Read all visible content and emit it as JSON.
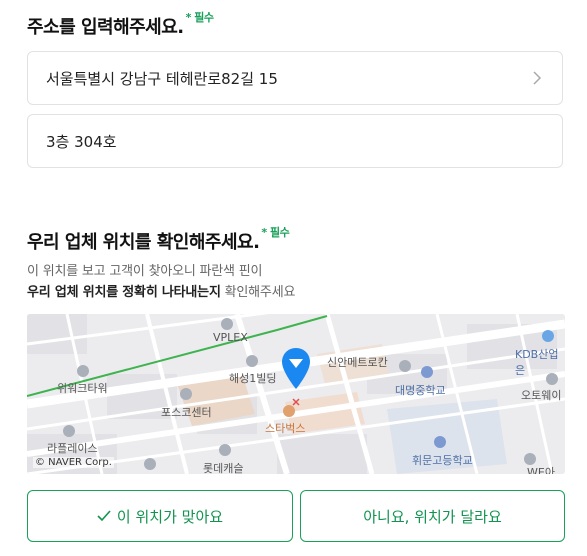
{
  "address_section": {
    "title": "주소를 입력해주세요.",
    "required": "* 필수",
    "address_value": "서울특별시 강남구 테헤란로82길 15",
    "detail_value": "3층 304호"
  },
  "location_section": {
    "title": "우리 업체 위치를 확인해주세요.",
    "required": "* 필수",
    "desc_line1": "이 위치를 보고 고객이 찾아오니 파란색 핀이",
    "desc_line2_bold": "우리 업체 위치를 정확히 나타내는지",
    "desc_line2_rest": " 확인해주세요"
  },
  "map": {
    "labels": {
      "vplex": "VPLEX",
      "wework": "위워크타워",
      "haesung": "해성1빌딩",
      "sinan": "신안메트로칸",
      "kdb": "KDB산업은",
      "posco": "포스코센터",
      "daemyung": "대명중학교",
      "ottoway": "오토웨이",
      "starbucks": "스타벅스",
      "lafeo": "라플레이스",
      "lotte": "롯데캐슬",
      "hwimun": "휘문고등학교",
      "wepi": "WE아",
      "copyright": "© NAVER Corp."
    },
    "pin_color": "#1a88f0"
  },
  "buttons": {
    "confirm": "이 위치가 맞아요",
    "reject": "아니요, 위치가 달라요"
  },
  "colors": {
    "accent": "#1aa05a",
    "pin": "#1a88f0"
  }
}
